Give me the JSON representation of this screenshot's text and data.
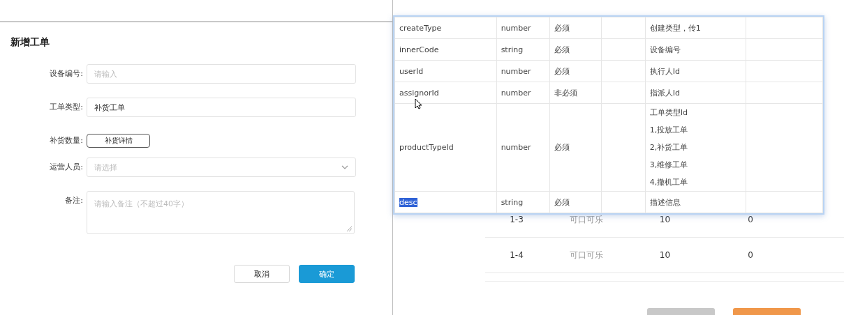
{
  "dialog": {
    "title": "新增工单",
    "fields": [
      {
        "kind": "input",
        "label": "设备编号:",
        "placeholder": "请输入"
      },
      {
        "kind": "input",
        "label": "工单类型:",
        "value": "补货工单"
      },
      {
        "kind": "button",
        "label": "补货数量:",
        "button": "补货详情"
      },
      {
        "kind": "select",
        "label": "运营人员:",
        "placeholder": "请选择"
      },
      {
        "kind": "textarea",
        "label": "备注:",
        "placeholder": "请输入备注（不超过40字）"
      }
    ],
    "buttons": [
      {
        "label": "取消",
        "primary": false
      },
      {
        "label": "确定",
        "primary": true
      }
    ]
  },
  "background_table": {
    "rows": [
      {
        "column_1": "1-3",
        "column_2": "可口可乐",
        "column_3": "10",
        "column_4": "0"
      },
      {
        "column_1": "1-4",
        "column_2": "可口可乐",
        "column_3": "10",
        "column_4": "0"
      }
    ],
    "footer_buttons": [
      {
        "color": "#c8c8c8"
      },
      {
        "color": "#f0974a"
      }
    ]
  },
  "popup_table": {
    "rows": [
      {
        "name": "createType",
        "type": "number",
        "required": "必须",
        "description": [
          "创建类型，传1"
        ],
        "name_selected": false
      },
      {
        "name": "innerCode",
        "type": "string",
        "required": "必须",
        "description": [
          "设备编号"
        ],
        "name_selected": false
      },
      {
        "name": "userId",
        "type": "number",
        "required": "必须",
        "description": [
          "执行人Id"
        ],
        "name_selected": false
      },
      {
        "name": "assignorId",
        "type": "number",
        "required": "非必须",
        "description": [
          "指派人Id"
        ],
        "name_selected": false
      },
      {
        "name": "productTypeId",
        "type": "number",
        "required": "必须",
        "description": [
          "工单类型Id",
          "1,投放工单",
          "2,补货工单",
          "3,维修工单",
          "4,撤机工单"
        ],
        "name_selected": false
      },
      {
        "name": "desc",
        "type": "string",
        "required": "必须",
        "description": [
          "描述信息"
        ],
        "name_selected": true
      }
    ]
  }
}
